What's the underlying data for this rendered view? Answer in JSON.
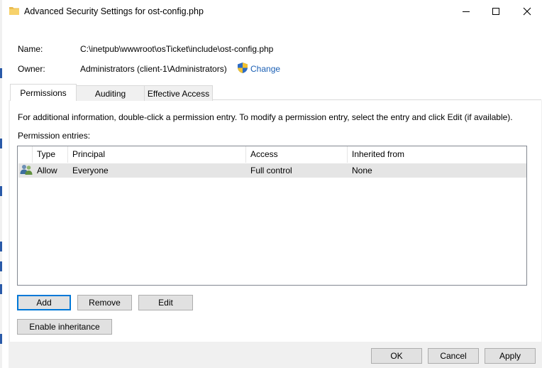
{
  "window": {
    "title": "Advanced Security Settings for ost-config.php"
  },
  "info": {
    "name_label": "Name:",
    "name_value": "C:\\inetpub\\wwwroot\\osTicket\\include\\ost-config.php",
    "owner_label": "Owner:",
    "owner_value": "Administrators (client-1\\Administrators)",
    "change_link": "Change"
  },
  "tabs": [
    {
      "label": "Permissions",
      "active": true
    },
    {
      "label": "Auditing",
      "active": false
    },
    {
      "label": "Effective Access",
      "active": false
    }
  ],
  "permissions": {
    "instructions": "For additional information, double-click a permission entry. To modify a permission entry, select the entry and click Edit (if available).",
    "entries_label": "Permission entries:",
    "columns": [
      "Type",
      "Principal",
      "Access",
      "Inherited from"
    ],
    "rows": [
      {
        "type": "Allow",
        "principal": "Everyone",
        "access": "Full control",
        "inherited": "None"
      }
    ]
  },
  "buttons": {
    "add": "Add",
    "remove": "Remove",
    "edit": "Edit",
    "enable_inheritance": "Enable inheritance",
    "ok": "OK",
    "cancel": "Cancel",
    "apply": "Apply"
  },
  "colors": {
    "accent": "#0078d7",
    "link": "#1a5fb4",
    "selected_row": "#e5e5e5"
  }
}
